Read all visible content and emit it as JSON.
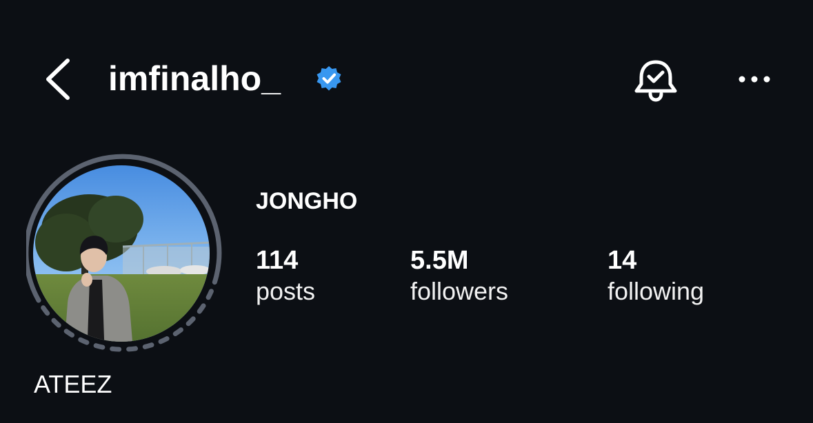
{
  "header": {
    "back_icon": "chevron-left-icon",
    "username": "imfinalho_",
    "verified_icon": "verified-badge-icon",
    "verified_color": "#3897f0",
    "bell_icon": "notification-bell-check-icon",
    "more_icon": "more-horizontal-icon"
  },
  "profile": {
    "full_name": "JONGHO",
    "bio": "ATEEZ",
    "avatar_ring_color": "#5c6370",
    "stats": {
      "posts": {
        "value": "114",
        "label": "posts"
      },
      "followers": {
        "value": "5.5M",
        "label": "followers"
      },
      "following": {
        "value": "14",
        "label": "following"
      }
    }
  }
}
